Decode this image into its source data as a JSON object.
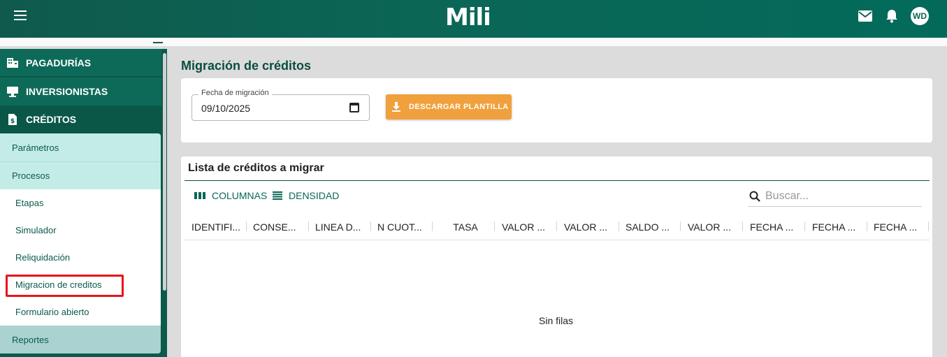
{
  "app": {
    "logo_text": "Mili",
    "avatar_initials": "WD"
  },
  "sidebar": {
    "groups": [
      {
        "label": "PAGADURÍAS",
        "icon": "building-icon"
      },
      {
        "label": "INVERSIONISTAS",
        "icon": "monitor-icon"
      },
      {
        "label": "CRÉDITOS",
        "icon": "money-file-icon"
      }
    ],
    "credits_sub": {
      "parametros": "Parámetros",
      "procesos": "Procesos",
      "items": [
        "Etapas",
        "Simulador",
        "Reliquidación",
        "Migracion de creditos",
        "Formulario abierto"
      ],
      "reportes": "Reportes"
    }
  },
  "page": {
    "title": "Migración de créditos"
  },
  "form": {
    "date_label": "Fecha de migración",
    "date_value": "09/10/2025",
    "download_label": "DESCARGAR PLANTILLA"
  },
  "list": {
    "title": "Lista de créditos a migrar",
    "columns_label": "COLUMNAS",
    "density_label": "DENSIDAD",
    "search_placeholder": "Buscar...",
    "headers": [
      "IDENTIFI...",
      "CONSE...",
      "LINEA D...",
      "N CUOT...",
      "TASA",
      "VALOR ...",
      "VALOR ...",
      "SALDO ...",
      "VALOR ...",
      "FECHA ...",
      "FECHA ...",
      "FECHA ..."
    ],
    "empty_text": "Sin filas"
  },
  "colors": {
    "primary": "#0b6656",
    "accent": "#f0a03c",
    "highlight": "#e8141b"
  }
}
